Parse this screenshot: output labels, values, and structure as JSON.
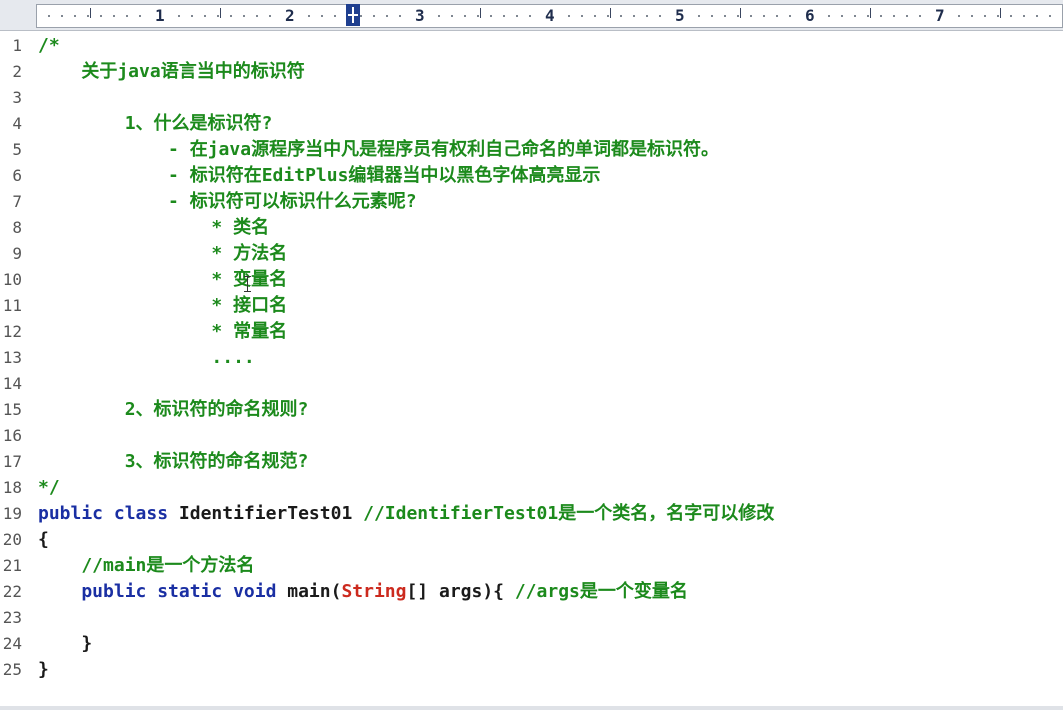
{
  "ruler": {
    "numbers": [
      "1",
      "2",
      "3",
      "4",
      "5",
      "6",
      "7"
    ]
  },
  "lines": [
    {
      "n": "1",
      "parts": [
        {
          "c": "cmt",
          "t": "/*"
        }
      ]
    },
    {
      "n": "2",
      "parts": [
        {
          "c": "cmt",
          "t": "    关于java语言当中的标识符"
        }
      ]
    },
    {
      "n": "3",
      "parts": []
    },
    {
      "n": "4",
      "parts": [
        {
          "c": "cmt",
          "t": "        1、什么是标识符?"
        }
      ]
    },
    {
      "n": "5",
      "parts": [
        {
          "c": "cmt",
          "t": "            - 在java源程序当中凡是程序员有权利自己命名的单词都是标识符。"
        }
      ]
    },
    {
      "n": "6",
      "parts": [
        {
          "c": "cmt",
          "t": "            - 标识符在EditPlus编辑器当中以黑色字体高亮显示"
        }
      ]
    },
    {
      "n": "7",
      "parts": [
        {
          "c": "cmt",
          "t": "            - 标识符可以标识什么元素呢?"
        }
      ]
    },
    {
      "n": "8",
      "parts": [
        {
          "c": "cmt",
          "t": "                * 类名"
        }
      ]
    },
    {
      "n": "9",
      "parts": [
        {
          "c": "cmt",
          "t": "                * 方法名"
        }
      ]
    },
    {
      "n": "10",
      "parts": [
        {
          "c": "cmt",
          "t": "                * 变量名"
        }
      ]
    },
    {
      "n": "11",
      "parts": [
        {
          "c": "cmt",
          "t": "                * 接口名"
        }
      ]
    },
    {
      "n": "12",
      "parts": [
        {
          "c": "cmt",
          "t": "                * 常量名"
        }
      ]
    },
    {
      "n": "13",
      "parts": [
        {
          "c": "cmt",
          "t": "                ...."
        }
      ]
    },
    {
      "n": "14",
      "parts": []
    },
    {
      "n": "15",
      "parts": [
        {
          "c": "cmt",
          "t": "        2、标识符的命名规则?"
        }
      ]
    },
    {
      "n": "16",
      "parts": []
    },
    {
      "n": "17",
      "parts": [
        {
          "c": "cmt",
          "t": "        3、标识符的命名规范?"
        }
      ]
    },
    {
      "n": "18",
      "parts": [
        {
          "c": "cmt",
          "t": "*/"
        }
      ]
    },
    {
      "n": "19",
      "parts": [
        {
          "c": "kw",
          "t": "public class "
        },
        {
          "c": "txt",
          "t": "IdentifierTest01 "
        },
        {
          "c": "cmt",
          "t": "//IdentifierTest01是一个类名，名字可以修改"
        }
      ]
    },
    {
      "n": "20",
      "parts": [
        {
          "c": "txt",
          "t": "{"
        }
      ]
    },
    {
      "n": "21",
      "parts": [
        {
          "c": "cmt",
          "t": "    //main是一个方法名"
        }
      ]
    },
    {
      "n": "22",
      "parts": [
        {
          "c": "kw",
          "t": "    public static void "
        },
        {
          "c": "txt",
          "t": "main("
        },
        {
          "c": "typ",
          "t": "String"
        },
        {
          "c": "txt",
          "t": "[] args){ "
        },
        {
          "c": "cmt",
          "t": "//args是一个变量名"
        }
      ]
    },
    {
      "n": "23",
      "parts": []
    },
    {
      "n": "24",
      "parts": [
        {
          "c": "txt",
          "t": "    }"
        }
      ]
    },
    {
      "n": "25",
      "parts": [
        {
          "c": "txt",
          "t": "}"
        }
      ]
    }
  ]
}
